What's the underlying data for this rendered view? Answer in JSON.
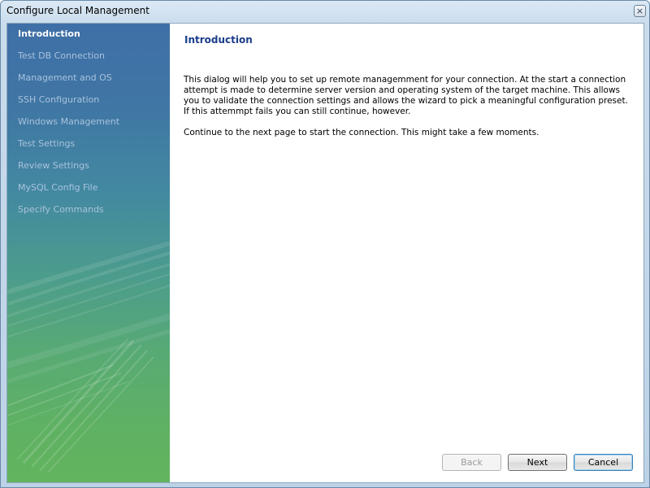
{
  "window": {
    "title": "Configure Local Management",
    "close_glyph": "×"
  },
  "sidebar": {
    "items": [
      {
        "label": "Introduction",
        "active": true
      },
      {
        "label": "Test DB Connection",
        "active": false
      },
      {
        "label": "Management and OS",
        "active": false
      },
      {
        "label": "SSH Configuration",
        "active": false
      },
      {
        "label": "Windows Management",
        "active": false
      },
      {
        "label": "Test Settings",
        "active": false
      },
      {
        "label": "Review Settings",
        "active": false
      },
      {
        "label": "MySQL Config File",
        "active": false
      },
      {
        "label": "Specify Commands",
        "active": false
      }
    ]
  },
  "main": {
    "title": "Introduction",
    "paragraph1": "This dialog will help you to set up remote managemment for your connection. At the start a connection attempt is made to determine server version and operating system of the target machine. This allows you to validate the connection settings and allows the wizard to pick a meaningful configuration preset. If this attemmpt fails you can still continue, however.",
    "paragraph2": "Continue to the next page to start the connection. This might take a few moments."
  },
  "buttons": {
    "back": "Back",
    "next": "Next",
    "cancel": "Cancel"
  },
  "colors": {
    "sidebar_active": "#ffffff",
    "sidebar_inactive": "#a9c2dc",
    "title_blue": "#1a3c8c"
  }
}
